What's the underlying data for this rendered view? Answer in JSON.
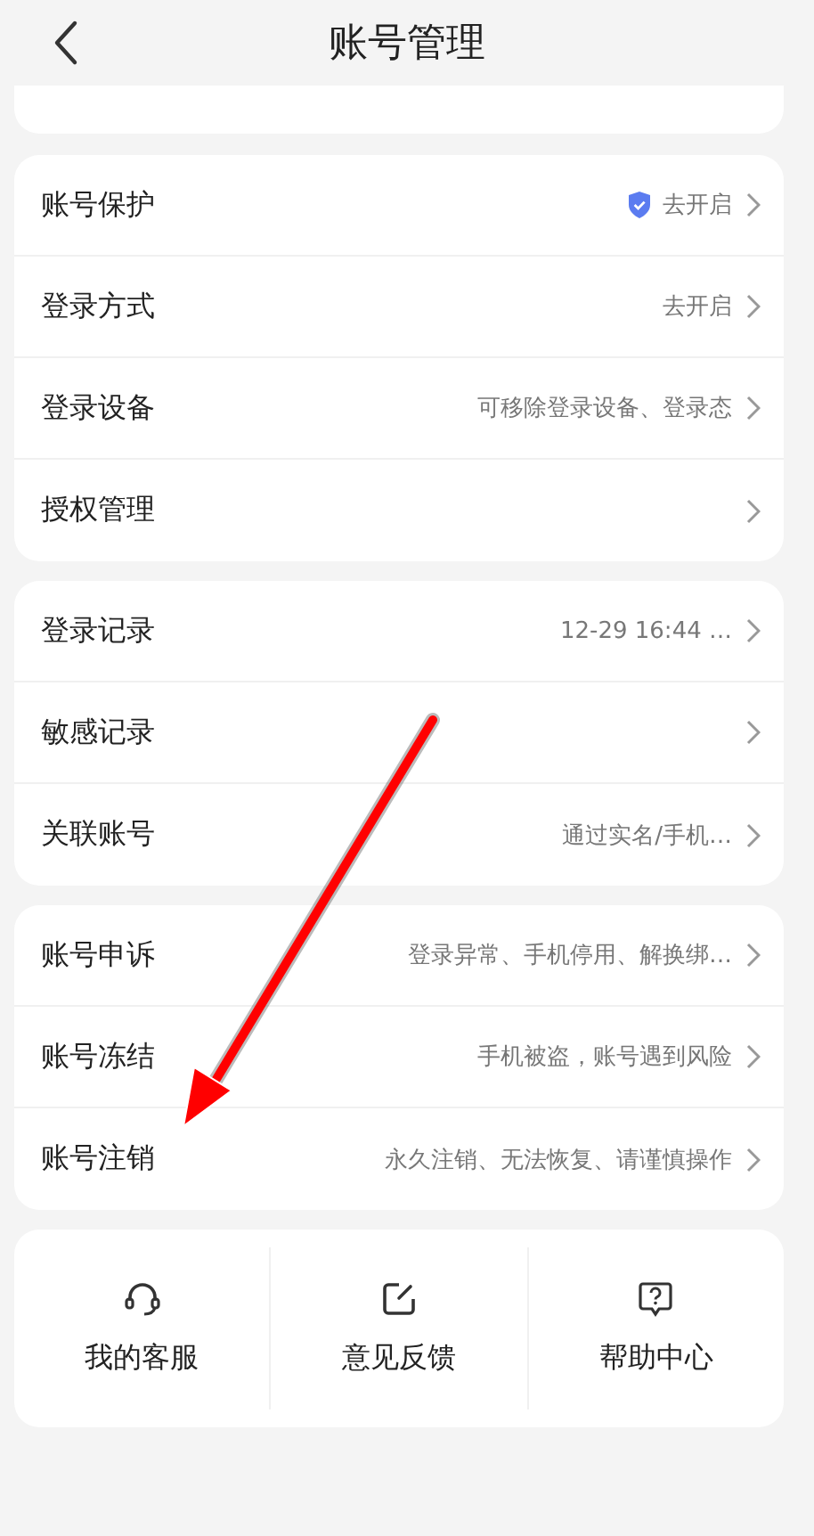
{
  "header": {
    "title": "账号管理"
  },
  "groups": [
    {
      "rows": [
        {
          "label": "账号保护",
          "value": "去开启",
          "shield": true
        },
        {
          "label": "登录方式",
          "value": "去开启",
          "shield": false
        },
        {
          "label": "登录设备",
          "value": "可移除登录设备、登录态",
          "shield": false
        },
        {
          "label": "授权管理",
          "shield": false
        }
      ]
    },
    {
      "rows": [
        {
          "label": "登录记录",
          "value": "12-29 16:44 …",
          "shield": false
        },
        {
          "label": "敏感记录",
          "shield": false
        },
        {
          "label": "关联账号",
          "value": "通过实名/手机…",
          "shield": false
        }
      ]
    },
    {
      "rows": [
        {
          "label": "账号申诉",
          "value": "登录异常、手机停用、解换绑…",
          "shield": false
        },
        {
          "label": "账号冻结",
          "value": "手机被盗，账号遇到风险",
          "shield": false
        },
        {
          "label": "账号注销",
          "value": "永久注销、无法恢复、请谨慎操作",
          "shield": false
        }
      ]
    }
  ],
  "shortcuts": [
    {
      "kind": "headset",
      "label": "我的客服"
    },
    {
      "kind": "edit",
      "label": "意见反馈"
    },
    {
      "kind": "help",
      "label": "帮助中心"
    }
  ],
  "annotation": {
    "kind": "arrow",
    "color": "#ff0000"
  }
}
